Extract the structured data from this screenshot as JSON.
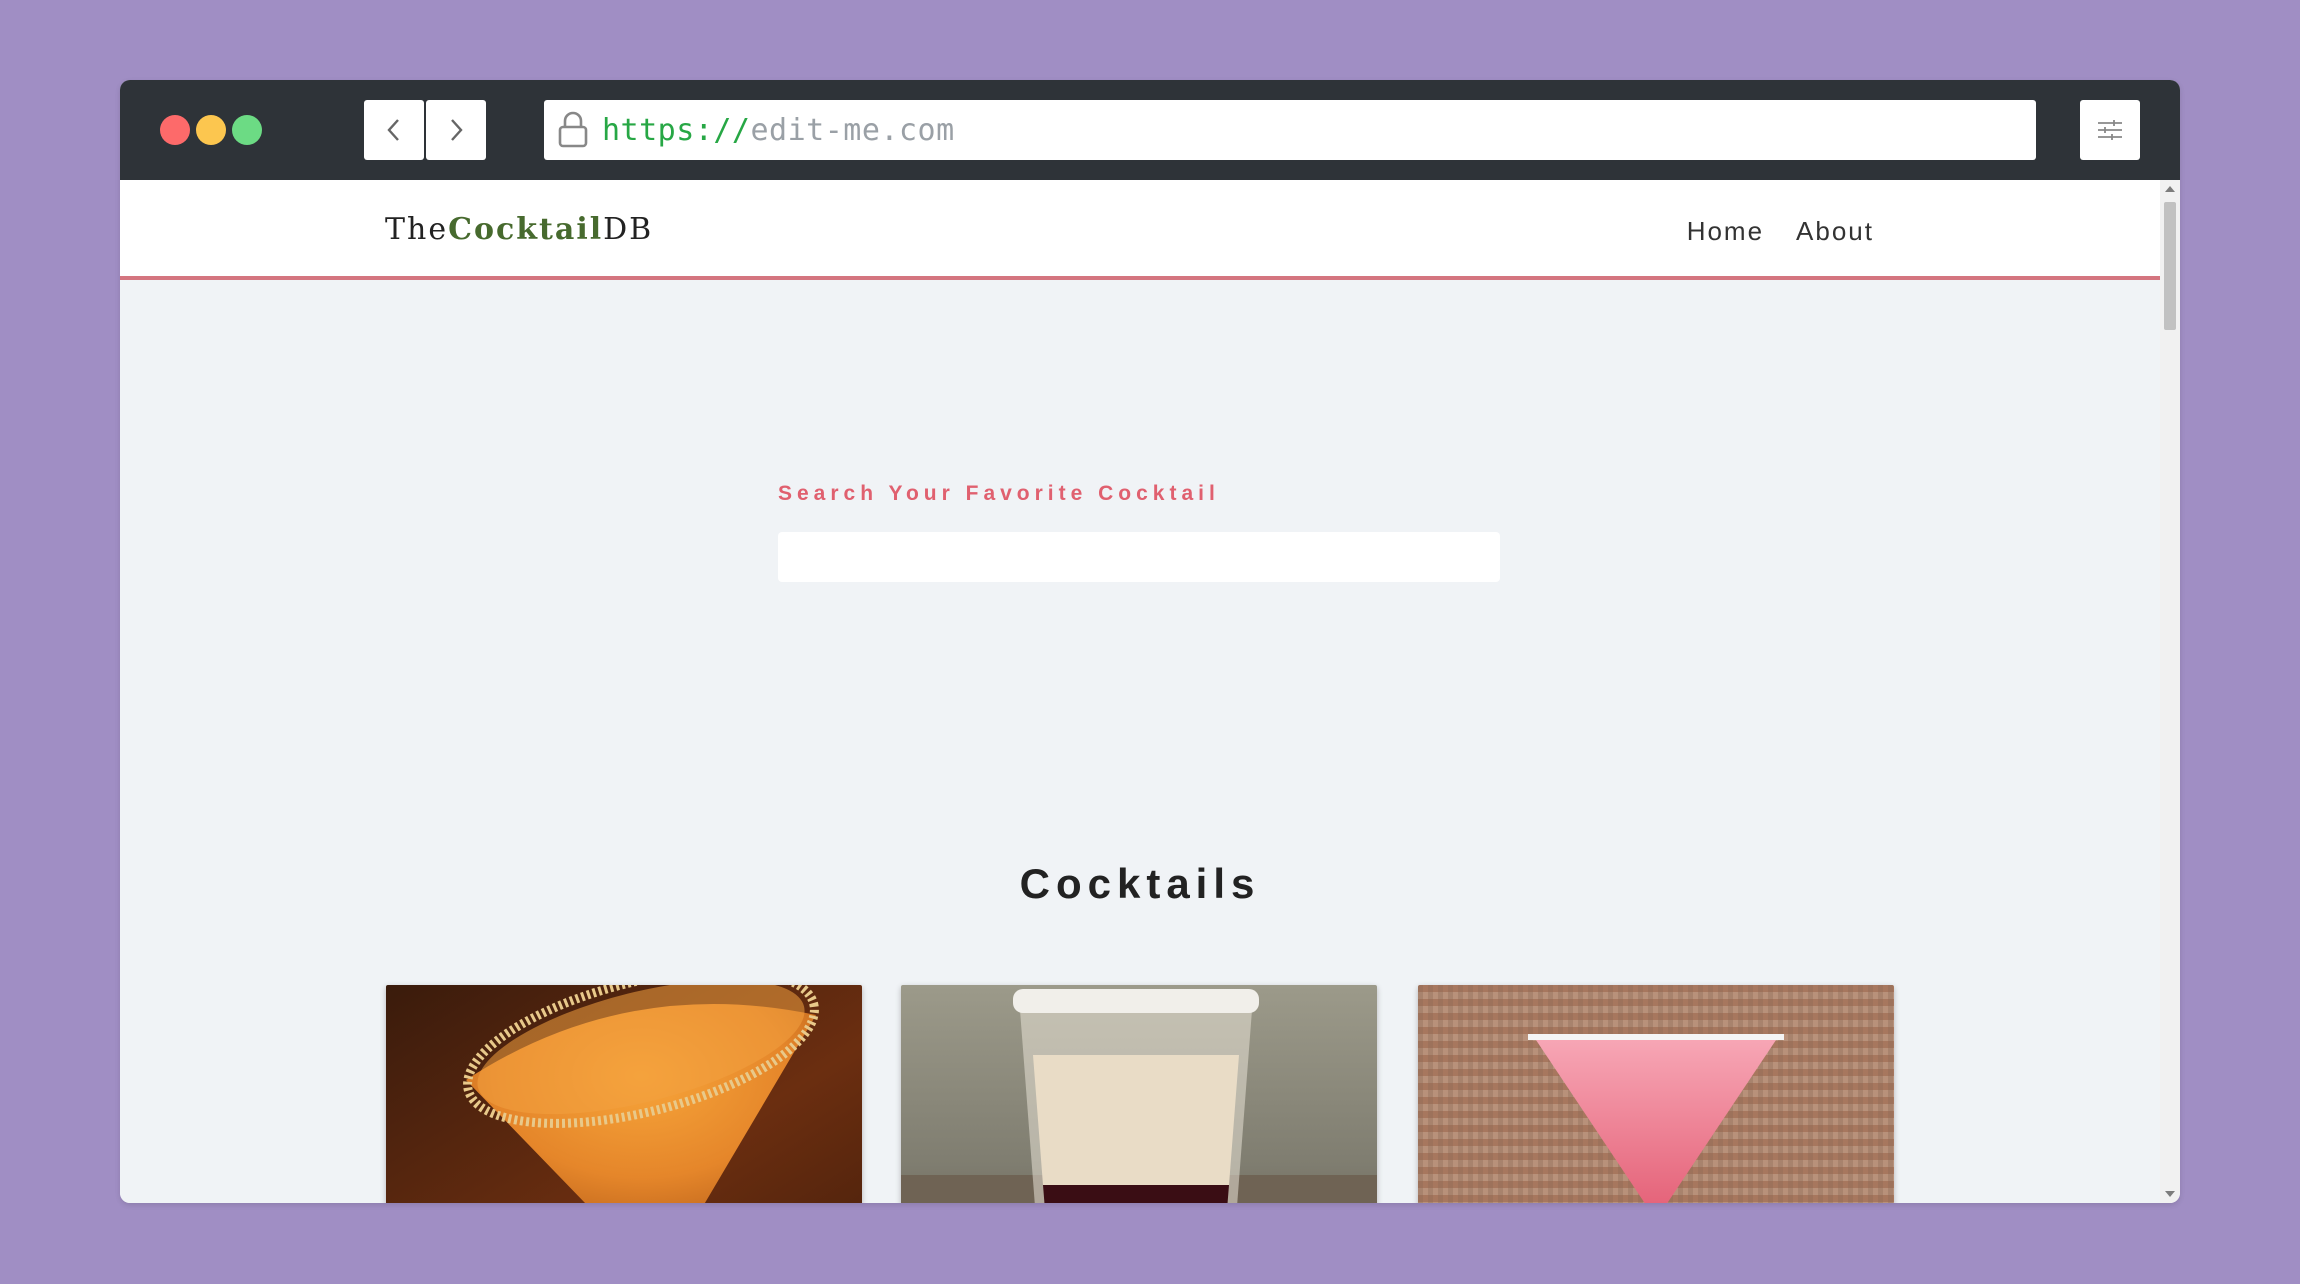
{
  "browser": {
    "url_scheme": "https://",
    "url_host": "edit-me.com"
  },
  "site": {
    "logo_prefix": "The",
    "logo_accent": "Cocktail",
    "logo_suffix": "DB",
    "nav": [
      "Home",
      "About"
    ]
  },
  "search": {
    "label": "Search Your Favorite Cocktail",
    "value": "",
    "placeholder": ""
  },
  "section": {
    "title": "Cocktails"
  },
  "cards": [
    {
      "image": "orange martini with sugar rim"
    },
    {
      "image": "layered shot with salted rim"
    },
    {
      "image": "pink cocktail in martini glass"
    }
  ],
  "colors": {
    "accent": "#e0606f",
    "logo_accent": "#476a2e",
    "nav_border": "#d4757f",
    "background": "#a08ec4"
  }
}
